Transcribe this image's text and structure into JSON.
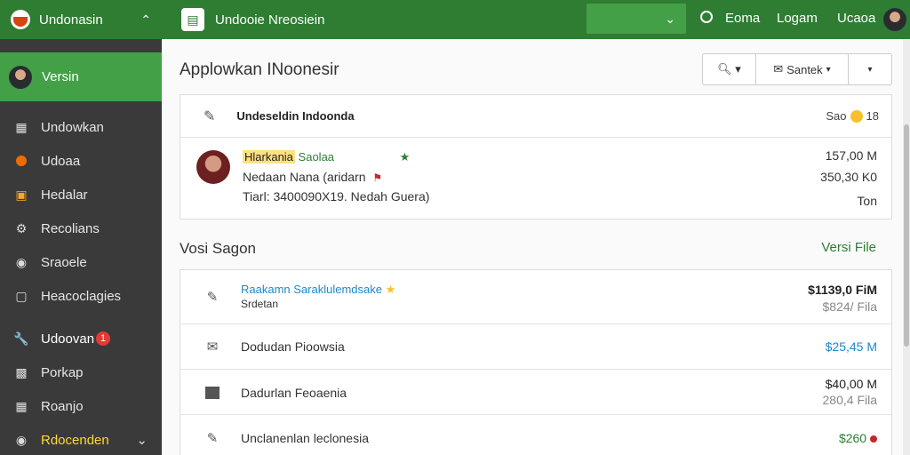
{
  "sidebar": {
    "brand": "Undonasin",
    "user": "Versin",
    "items": [
      {
        "label": "Undowkan",
        "icon": "grid-icon"
      },
      {
        "label": "Udoaa",
        "icon": "orange-dot-icon"
      },
      {
        "label": "Hedalar",
        "icon": "image-icon"
      },
      {
        "label": "Recolians",
        "icon": "puzzle-icon"
      },
      {
        "label": "Sraoele",
        "icon": "gear-icon"
      },
      {
        "label": "Heacoclagies",
        "icon": "monitor-icon"
      },
      {
        "label": "Udoovan",
        "icon": "wrench-icon",
        "badge": "1"
      },
      {
        "label": "Porkap",
        "icon": "window-icon"
      },
      {
        "label": "Roanjo",
        "icon": "table-icon"
      },
      {
        "label": "Rdocenden",
        "icon": "circle-icon"
      }
    ]
  },
  "topbar": {
    "app_title": "Undooie Nreosiein",
    "links": [
      "Eoma",
      "Logam",
      "Ucaoa"
    ]
  },
  "main": {
    "title": "Applowkan INoonesir",
    "toolbar": {
      "sort_label": "Santek"
    },
    "card1": {
      "heading": "Undeseldin Indoonda",
      "heading_meta": "Sao",
      "heading_count": "18",
      "tag": "Hlarkania",
      "tag_status": "Saolaa",
      "line2": "Nedaan Nana (aridarn",
      "line3": "Tiarl: 3400090X19. Nedah Guera)",
      "values": [
        "157,00 M",
        "350,30 K0",
        "Ton"
      ]
    },
    "section": {
      "title": "Vosi Sagon",
      "link": "Versi File"
    },
    "rows": [
      {
        "title": "Raakamn Saraklulemdsake",
        "subtitle": "Srdetan",
        "value": "$1139,0 FiM",
        "subvalue": "$824/ Fila",
        "icon": "pencil-icon"
      },
      {
        "title": "Dodudan Pioowsia",
        "value": "$25,45 M",
        "icon": "envelope-icon"
      },
      {
        "title": "Dadurlan Feoaenia",
        "value": "$40,00 M",
        "subvalue": "280,4 Fila",
        "icon": "square-icon"
      },
      {
        "title": "Unclanenlan leclonesia",
        "value": "$260",
        "icon": "pencil-icon"
      }
    ]
  },
  "colors": {
    "primary": "#2e7d32",
    "accent": "#43a047",
    "sidebar": "#3a3a3a",
    "badge": "#e53935",
    "link_blue": "#1e88c8"
  }
}
